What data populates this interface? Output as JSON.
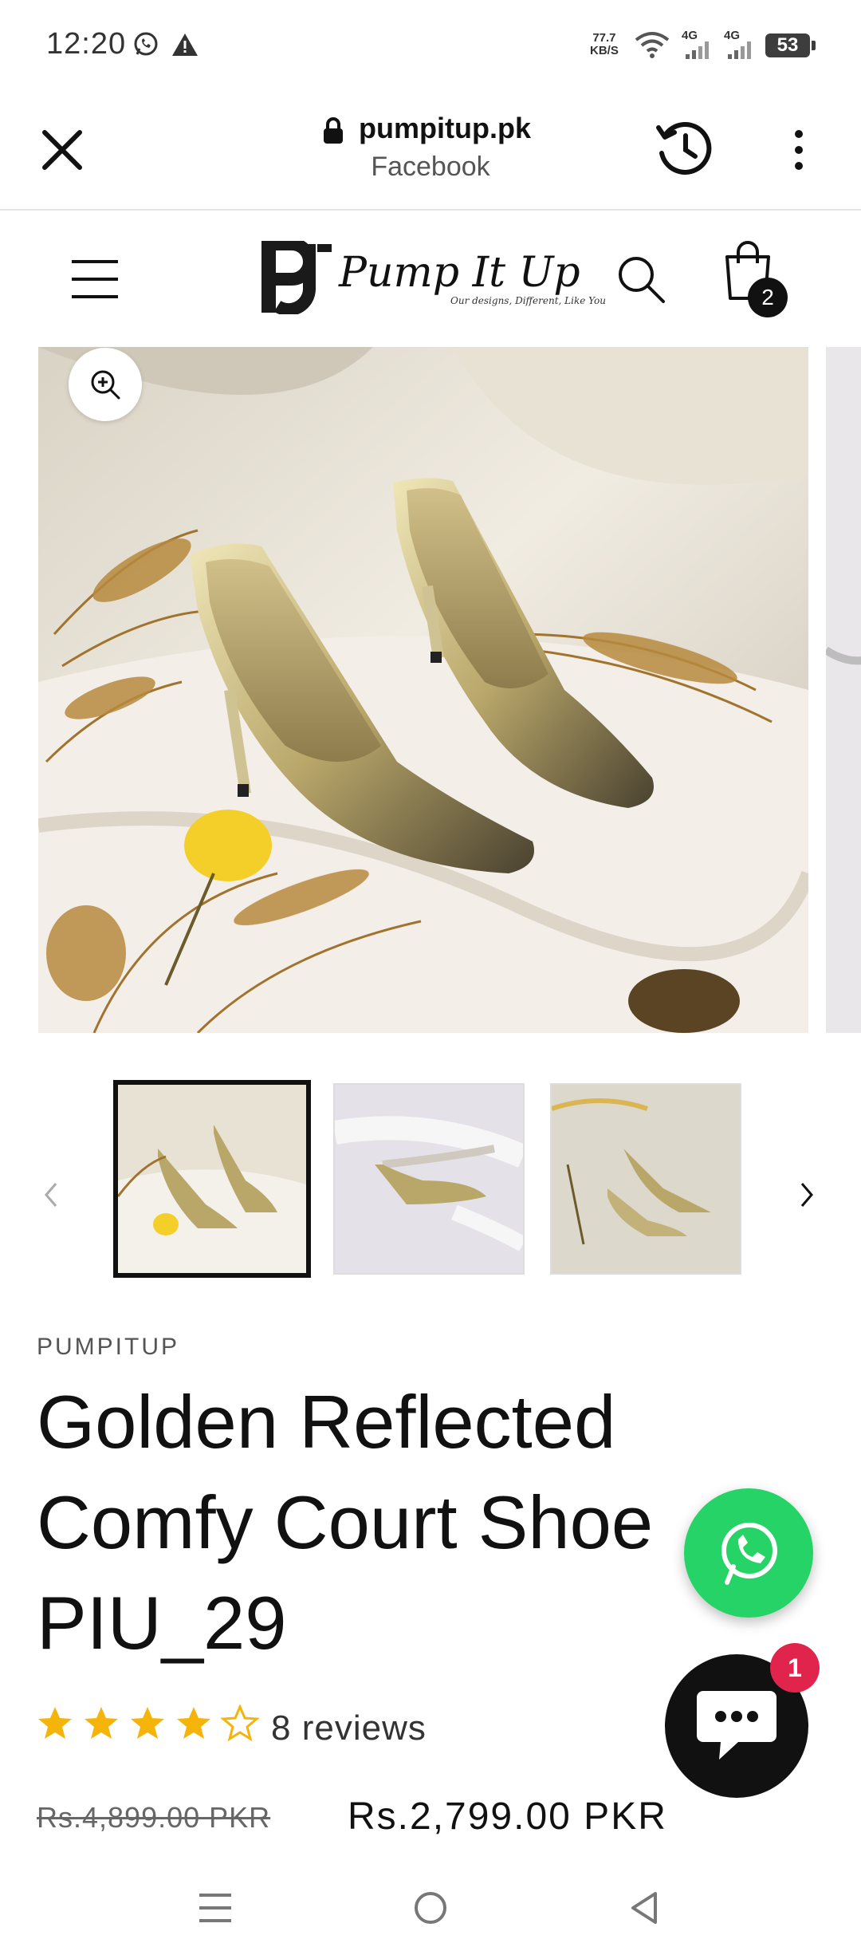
{
  "status_bar": {
    "time": "12:20",
    "speed_value": "77.7",
    "speed_unit": "KB/S",
    "net1": "4G",
    "net2": "4G",
    "battery": "53"
  },
  "browser": {
    "host": "pumpitup.pk",
    "origin": "Facebook"
  },
  "store": {
    "logo_text": "Pump It Up",
    "logo_tagline": "Our designs, Different, Like You",
    "cart_count": "2"
  },
  "product": {
    "vendor": "PUMPITUP",
    "title": "Golden Reflected Comfy Court Shoe PIU_29",
    "rating_stars": 4,
    "rating_max": 5,
    "reviews": "8 reviews",
    "price_old": "Rs.4,899.00 PKR",
    "price_new": "Rs.2,799.00 PKR"
  },
  "gallery": {
    "thumb_count": 3,
    "selected_index": 0
  },
  "chat": {
    "unread": "1"
  },
  "colors": {
    "star": "#f5b40a",
    "whatsapp": "#25d366",
    "badge": "#e0244b"
  }
}
